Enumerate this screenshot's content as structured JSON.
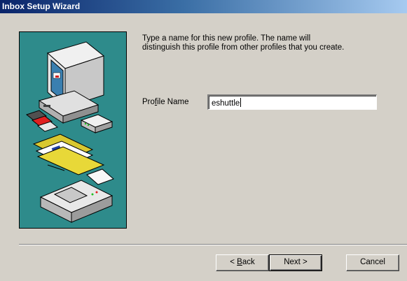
{
  "window": {
    "title": "Inbox Setup Wizard"
  },
  "instructions": {
    "line1": "Type a name for this new profile. The name will",
    "line2": "distinguish this profile from other profiles that you create."
  },
  "profile": {
    "label_prefix": "Pro",
    "label_mnemonic": "f",
    "label_suffix": "ile Name",
    "value": "eshuttle"
  },
  "buttons": {
    "back_prefix": "< ",
    "back_mnemonic": "B",
    "back_suffix": "ack",
    "next": "Next >",
    "cancel": "Cancel"
  },
  "illustration": {
    "icons": [
      "computer-icon",
      "floppy-disks-icon",
      "modem-icon",
      "folder-icon",
      "fax-machine-icon"
    ],
    "background_color": "#2e8b8b"
  }
}
